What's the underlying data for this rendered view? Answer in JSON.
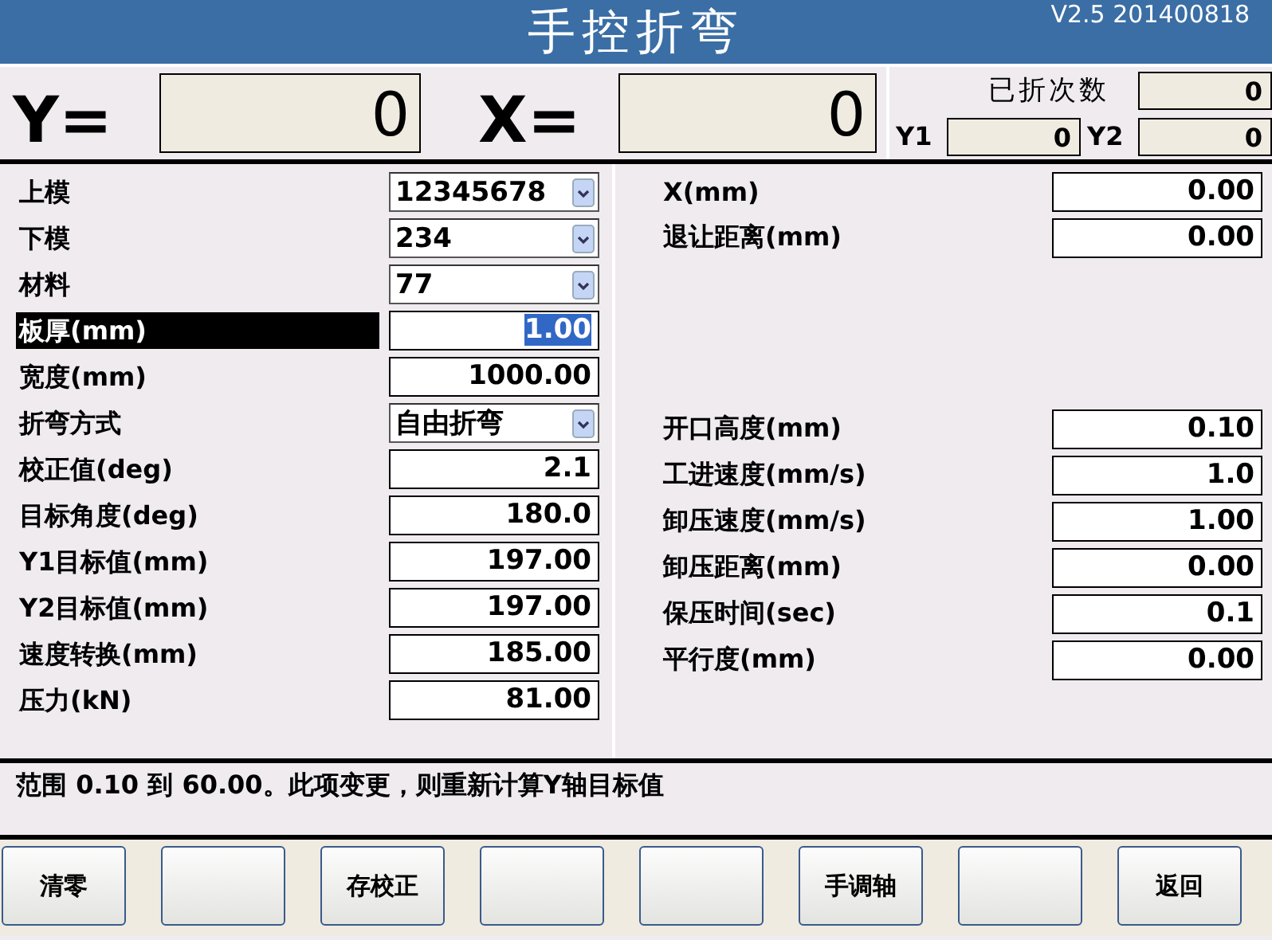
{
  "window": {
    "title": "手控折弯",
    "version": "V2.5 201400818"
  },
  "readouts": {
    "y_label": "Y=",
    "y_value": "0",
    "x_label": "X=",
    "x_value": "0",
    "count_label": "已折次数",
    "count_value": "0",
    "y1_label": "Y1",
    "y1_value": "0",
    "y2_label": "Y2",
    "y2_value": "0"
  },
  "left_fields": [
    {
      "label": "上模",
      "value": "12345678",
      "kind": "select",
      "selected": false
    },
    {
      "label": "下模",
      "value": "234",
      "kind": "select",
      "selected": false
    },
    {
      "label": "材料",
      "value": "77",
      "kind": "select",
      "selected": false
    },
    {
      "label": "板厚(mm)",
      "value": "1.00",
      "kind": "input",
      "selected": true
    },
    {
      "label": "宽度(mm)",
      "value": "1000.00",
      "kind": "input",
      "selected": false
    },
    {
      "label": "折弯方式",
      "value": "自由折弯",
      "kind": "select",
      "selected": false
    },
    {
      "label": "校正值(deg)",
      "value": "2.1",
      "kind": "input",
      "selected": false
    },
    {
      "label": "目标角度(deg)",
      "value": "180.0",
      "kind": "input",
      "selected": false
    },
    {
      "label": "Y1目标值(mm)",
      "value": "197.00",
      "kind": "input",
      "selected": false
    },
    {
      "label": "Y2目标值(mm)",
      "value": "197.00",
      "kind": "input",
      "selected": false
    },
    {
      "label": "速度转换(mm)",
      "value": "185.00",
      "kind": "input",
      "selected": false
    },
    {
      "label": "压力(kN)",
      "value": "81.00",
      "kind": "input",
      "selected": false
    }
  ],
  "right_top_fields": [
    {
      "label": "X(mm)",
      "value": "0.00",
      "selected": false
    },
    {
      "label": "退让距离(mm)",
      "value": "0.00",
      "selected": false
    }
  ],
  "right_bottom_fields": [
    {
      "label": "开口高度(mm)",
      "value": "0.10",
      "selected": false
    },
    {
      "label": "工进速度(mm/s)",
      "value": "1.0",
      "selected": false
    },
    {
      "label": "卸压速度(mm/s)",
      "value": "1.00",
      "selected": false
    },
    {
      "label": "卸压距离(mm)",
      "value": "0.00",
      "selected": false
    },
    {
      "label": "保压时间(sec)",
      "value": "0.1",
      "selected": false
    },
    {
      "label": "平行度(mm)",
      "value": "0.00",
      "selected": false
    }
  ],
  "status_text": "范围 0.10 到 60.00。此项变更，则重新计算Y轴目标值",
  "buttons": [
    {
      "kind": "labeled",
      "label": "清零"
    },
    {
      "kind": "blank"
    },
    {
      "kind": "labeled",
      "label": "存校正"
    },
    {
      "kind": "blank"
    },
    {
      "kind": "blank"
    },
    {
      "kind": "labeled",
      "label": "手调轴"
    },
    {
      "kind": "blank"
    },
    {
      "kind": "labeled",
      "label": "返回"
    }
  ]
}
